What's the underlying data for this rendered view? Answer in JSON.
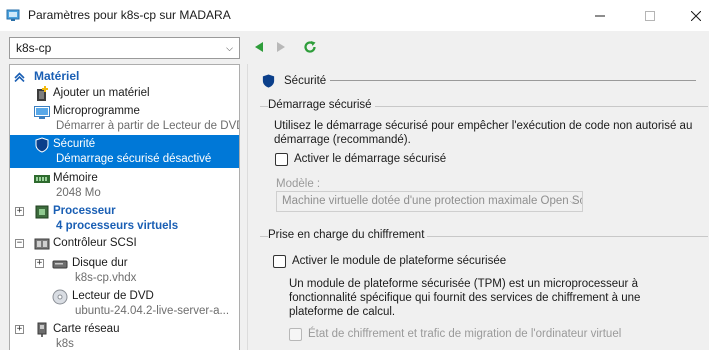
{
  "window": {
    "title": "Paramètres pour k8s-cp sur MADARA"
  },
  "vm_selector": {
    "value": "k8s-cp"
  },
  "sidebar": {
    "category_header": "Matériel",
    "items": [
      {
        "label": "Ajouter un matériel",
        "sub": ""
      },
      {
        "label": "Microprogramme",
        "sub": "Démarrer à partir de Lecteur de DVD"
      },
      {
        "label": "Sécurité",
        "sub": "Démarrage sécurisé désactivé"
      },
      {
        "label": "Mémoire",
        "sub": "2048 Mo"
      },
      {
        "label": "Processeur",
        "sub": "4 processeurs virtuels"
      },
      {
        "label": "Contrôleur SCSI",
        "sub": ""
      },
      {
        "label": "Disque dur",
        "sub": "k8s-cp.vhdx"
      },
      {
        "label": "Lecteur de DVD",
        "sub": "ubuntu-24.04.2-live-server-a..."
      },
      {
        "label": "Carte réseau",
        "sub": "k8s"
      }
    ]
  },
  "main": {
    "section_title": "Sécurité",
    "secure_boot": {
      "group_title": "Démarrage sécurisé",
      "description": "Utilisez le démarrage sécurisé pour empêcher l'exécution de code non autorisé au démarrage (recommandé).",
      "checkbox_label": "Activer le démarrage sécurisé",
      "checked": false,
      "template_label": "Modèle :",
      "template_value": "Machine virtuelle dotée d'une protection maximale Open Sou"
    },
    "encryption": {
      "group_title": "Prise en charge du chiffrement",
      "tpm_checkbox_label": "Activer le module de plateforme sécurisée",
      "tpm_checked": false,
      "tpm_description": "Un module de plateforme sécurisée (TPM) est un microprocesseur à fonctionnalité spécifique qui fournit des services de chiffrement à une plateforme de calcul.",
      "migration_checkbox_label": "État de chiffrement et trafic de migration de l'ordinateur virtuel",
      "migration_checked": false
    }
  },
  "colors": {
    "selection": "#0078d7",
    "accent_text": "#1a5fb4",
    "nav_green": "#2e9d3a"
  }
}
